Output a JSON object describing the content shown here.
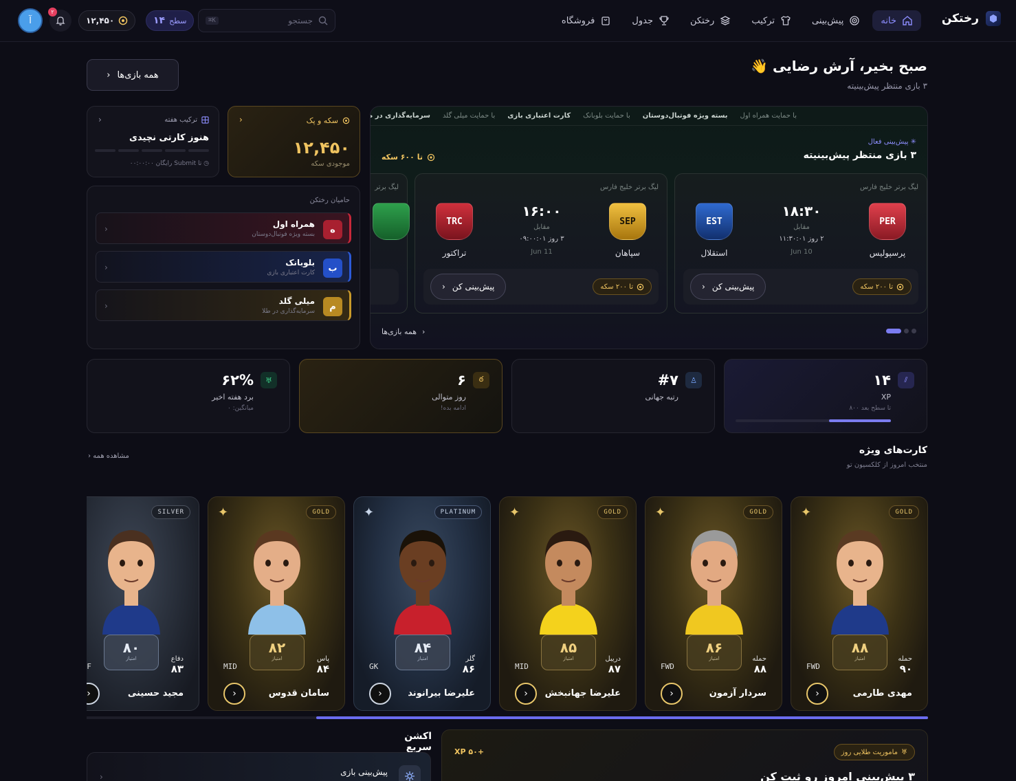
{
  "nav": {
    "brand": "رختکن",
    "links": [
      {
        "label": "خانه",
        "icon": "home-icon"
      },
      {
        "label": "پیش‌بینی",
        "icon": "target-icon"
      },
      {
        "label": "ترکیب",
        "icon": "shirt-icon"
      },
      {
        "label": "رختکن",
        "icon": "layers-icon"
      },
      {
        "label": "جدول",
        "icon": "trophy-icon"
      },
      {
        "label": "فروشگاه",
        "icon": "bag-icon"
      }
    ],
    "search_placeholder": "جستجو",
    "search_kbd": "K⌘",
    "level_label": "سطح",
    "level_value": "۱۴",
    "coins": "۱۲,۴۵۰",
    "notif_count": "۲",
    "avatar_letter": "آ"
  },
  "greeting": {
    "title": "صبح بخیر، آرش رضایی",
    "emoji": "👋",
    "subtitle": "۳ بازی منتظر پیش‌بینیته",
    "all_games": "همه بازی‌ها"
  },
  "hero": {
    "ticker": [
      {
        "text": "با حمایت همراه اول",
        "bold": false
      },
      {
        "text": "بسته ویژه فوتبال‌دوستان",
        "bold": true
      },
      {
        "text": "با حمایت بلوبانک",
        "bold": false
      },
      {
        "text": "کارت اعتباری بازی",
        "bold": true
      },
      {
        "text": "با حمایت میلی گلد",
        "bold": false
      },
      {
        "text": "سرمایه‌گذاری در طلا",
        "bold": true
      }
    ],
    "tag": "پیش‌بینی فعال",
    "title": "۳ بازی منتظر پیش‌بینیته",
    "coins_upto": "تا ۶۰۰ سکه",
    "footer": "همه بازی‌ها",
    "matches": [
      {
        "league": "لیگ برتر خلیج فارس",
        "home": {
          "code": "PER",
          "name": "پرسپولیس",
          "color": "#c8283a"
        },
        "away": {
          "code": "EST",
          "name": "استقلال",
          "color": "#1f57b4"
        },
        "time": "۱۸:۳۰",
        "vs": "مقابل",
        "countdown": "۲ روز ۱۱:۳۰:۰۱",
        "date": "Jun 10",
        "reward": "تا ۲۰۰ سکه",
        "cta": "پیش‌بینی کن"
      },
      {
        "league": "لیگ برتر خلیج فارس",
        "home": {
          "code": "SEP",
          "name": "سپاهان",
          "color": "#d8a21c"
        },
        "away": {
          "code": "TRC",
          "name": "تراکتور",
          "color": "#b0202c"
        },
        "time": "۱۶:۰۰",
        "vs": "مقابل",
        "countdown": "۳ روز ۰۹:۰۰:۰۱",
        "date": "Jun 11",
        "reward": "تا ۲۰۰ سکه",
        "cta": "پیش‌بینی کن"
      },
      {
        "league": "لیگ برتر",
        "reward": "تا"
      }
    ]
  },
  "coin_box": {
    "title": "سکه و پک",
    "value": "۱۲,۴۵۰",
    "sub": "موجودی سکه"
  },
  "week_box": {
    "title": "ترکیب هفته",
    "value": "هنوز کارتی نچیدی",
    "sub": "تا Submit رایگان ۰۰:۰۰:۰۰"
  },
  "sponsors": {
    "title": "حامیان رختکن",
    "items": [
      {
        "letter": "ه",
        "name": "همراه اول",
        "desc": "بسته ویژه فوتبال‌دوستان",
        "color": "#c8283a",
        "bg": "#2a1420"
      },
      {
        "letter": "ب",
        "name": "بلوبانک",
        "desc": "کارت اعتباری بازی",
        "color": "#2c5ad8",
        "bg": "#141c36"
      },
      {
        "letter": "م",
        "name": "میلی گلد",
        "desc": "سرمایه‌گذاری در طلا",
        "color": "#c99a2a",
        "bg": "#2a2414"
      }
    ]
  },
  "stats": [
    {
      "value": "۱۴",
      "label": "XP",
      "sub": "تا سطح بعد ۸۰۰",
      "icon": "bars-icon",
      "progress": 0.4
    },
    {
      "value": "#۷",
      "label": "رتبه جهانی",
      "sub": "",
      "icon": "rank-icon"
    },
    {
      "value": "۶",
      "label": "روز متوالی",
      "sub": "ادامه بده!",
      "icon": "flame-icon"
    },
    {
      "value": "۶۲%",
      "label": "برد هفته اخیر",
      "sub": "میانگین: ۰",
      "icon": "cup-icon"
    }
  ],
  "featured": {
    "title": "کارت‌های ویژه",
    "subtitle": "منتخب امروز از کلکسیون تو",
    "see_all": "مشاهده همه",
    "rating_label": "امتیاز",
    "cards": [
      {
        "tier": "GOLD",
        "rating": "۸۸",
        "pos": "FWD",
        "stat_label": "حمله",
        "stat_value": "۹۰",
        "name": "مهدی طارمی",
        "hair": "#5a3a22",
        "shirt": "#1f3a8a",
        "skin": "#e8b48c"
      },
      {
        "tier": "GOLD",
        "rating": "۸۶",
        "pos": "FWD",
        "stat_label": "حمله",
        "stat_value": "۸۸",
        "name": "سردار آزمون",
        "hair": "#9a9a9a",
        "shirt": "#f0c820",
        "skin": "#e2a982"
      },
      {
        "tier": "GOLD",
        "rating": "۸۵",
        "pos": "MID",
        "stat_label": "دریبل",
        "stat_value": "۸۷",
        "name": "علیرضا جهانبخش",
        "hair": "#2a1a10",
        "shirt": "#f4d21c",
        "skin": "#c48a5e"
      },
      {
        "tier": "PLATINUM",
        "rating": "۸۴",
        "pos": "GK",
        "stat_label": "گلر",
        "stat_value": "۸۶",
        "name": "علیرضا بیرانوند",
        "hair": "#1a1208",
        "shirt": "#c8202c",
        "skin": "#6a3e22"
      },
      {
        "tier": "GOLD",
        "rating": "۸۲",
        "pos": "MID",
        "stat_label": "پاس",
        "stat_value": "۸۴",
        "name": "سامان قدوس",
        "hair": "#5a3820",
        "shirt": "#8ec0e8",
        "skin": "#e4ae88"
      },
      {
        "tier": "SILVER",
        "rating": "۸۰",
        "pos": "DEF",
        "stat_label": "دفاع",
        "stat_value": "۸۳",
        "name": "مجید حسینی",
        "hair": "#4a3020",
        "shirt": "#1f3a8a",
        "skin": "#e8b48c"
      }
    ]
  },
  "quick": {
    "title": "اکشن سریع",
    "item": "پیش‌بینی بازی"
  },
  "mission": {
    "tag": "ماموریت طلایی روز",
    "xp": "+۵۰ XP",
    "title": "۳ پیش‌بینی امروز رو ثبت کن"
  }
}
